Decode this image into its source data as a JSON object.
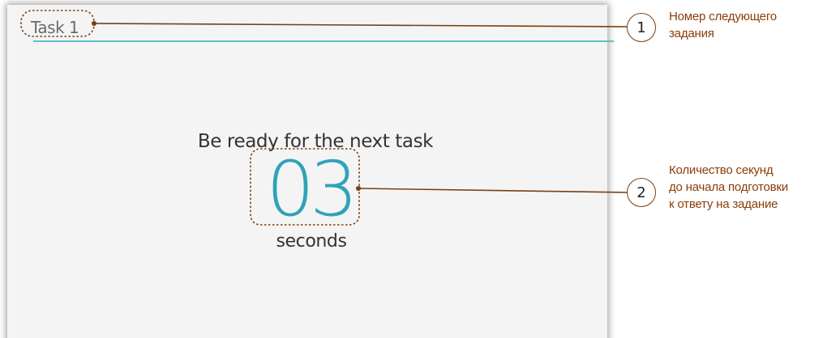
{
  "app": {
    "task_label": "Task 1",
    "ready_text": "Be ready for the next task",
    "countdown_value": "03",
    "seconds_label": "seconds"
  },
  "annotations": [
    {
      "number": "1",
      "lines": [
        "Номер следующего",
        "задания"
      ]
    },
    {
      "number": "2",
      "lines": [
        "Количество секунд",
        "до начала подготовки",
        "к ответу на задание"
      ]
    }
  ],
  "colors": {
    "accent": "#2fa3b8",
    "header_line": "#5fc0cc",
    "annotation": "#8a3d06",
    "background": "#f4f4f4"
  }
}
